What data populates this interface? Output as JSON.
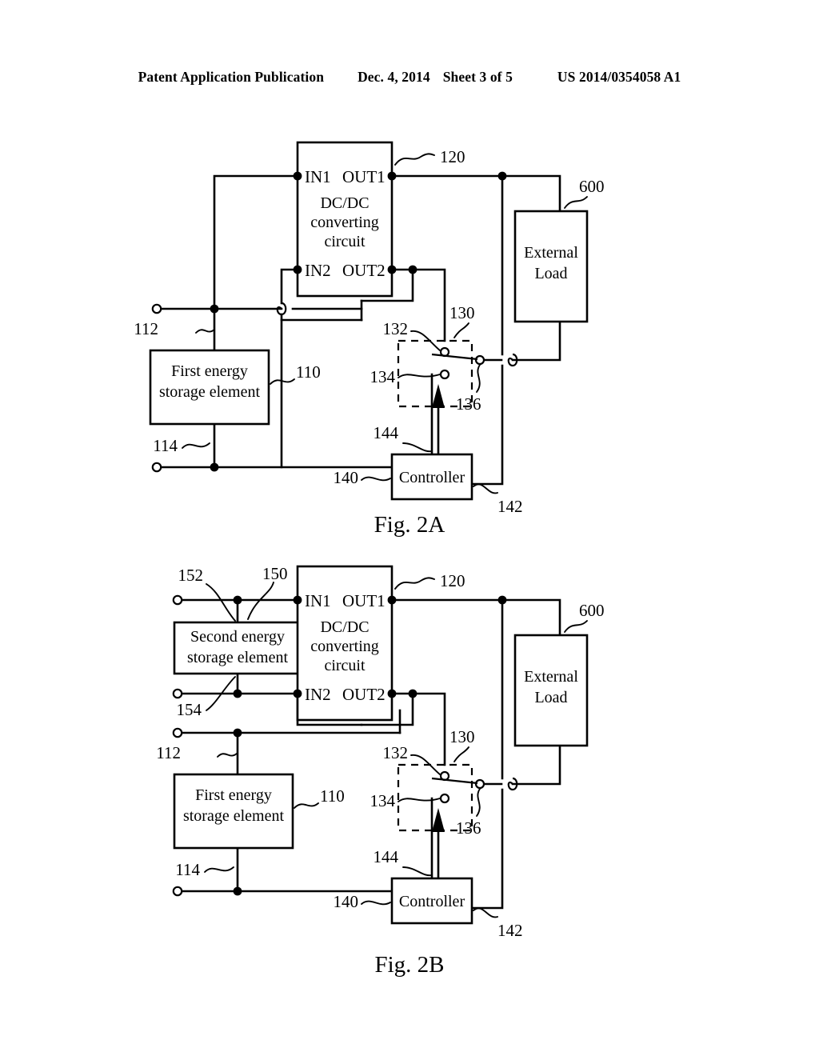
{
  "header": {
    "publication": "Patent Application Publication",
    "date": "Dec. 4, 2014",
    "sheet": "Sheet 3 of 5",
    "number": "US 2014/0354058 A1"
  },
  "figures": [
    {
      "id": "fig-2a",
      "caption": "Fig. 2A",
      "blocks": {
        "converter": {
          "ref": "120",
          "line1": "DC/DC",
          "line2": "converting",
          "line3": "circuit",
          "ports": {
            "in1": "IN1",
            "out1": "OUT1",
            "in2": "IN2",
            "out2": "OUT2"
          }
        },
        "first_storage": {
          "ref": "110",
          "line1": "First energy",
          "line2": "storage element",
          "terminal_top": "112",
          "terminal_bottom": "114"
        },
        "switch": {
          "ref": "130",
          "terminal_a": "132",
          "terminal_b": "134",
          "terminal_common": "136"
        },
        "controller": {
          "ref": "140",
          "label": "Controller",
          "signal_out": "142",
          "signal_in": "144"
        },
        "load": {
          "ref": "600",
          "line1": "External",
          "line2": "Load"
        }
      }
    },
    {
      "id": "fig-2b",
      "caption": "Fig. 2B",
      "blocks": {
        "converter": {
          "ref": "120",
          "line1": "DC/DC",
          "line2": "converting",
          "line3": "circuit",
          "ports": {
            "in1": "IN1",
            "out1": "OUT1",
            "in2": "IN2",
            "out2": "OUT2"
          }
        },
        "second_storage": {
          "ref": "150",
          "line1": "Second energy",
          "line2": "storage element",
          "terminal_top": "152",
          "terminal_bottom": "154"
        },
        "first_storage": {
          "ref": "110",
          "line1": "First energy",
          "line2": "storage element",
          "terminal_top": "112",
          "terminal_bottom": "114"
        },
        "switch": {
          "ref": "130",
          "terminal_a": "132",
          "terminal_b": "134",
          "terminal_common": "136"
        },
        "controller": {
          "ref": "140",
          "label": "Controller",
          "signal_out": "142",
          "signal_in": "144"
        },
        "load": {
          "ref": "600",
          "line1": "External",
          "line2": "Load"
        }
      }
    }
  ]
}
